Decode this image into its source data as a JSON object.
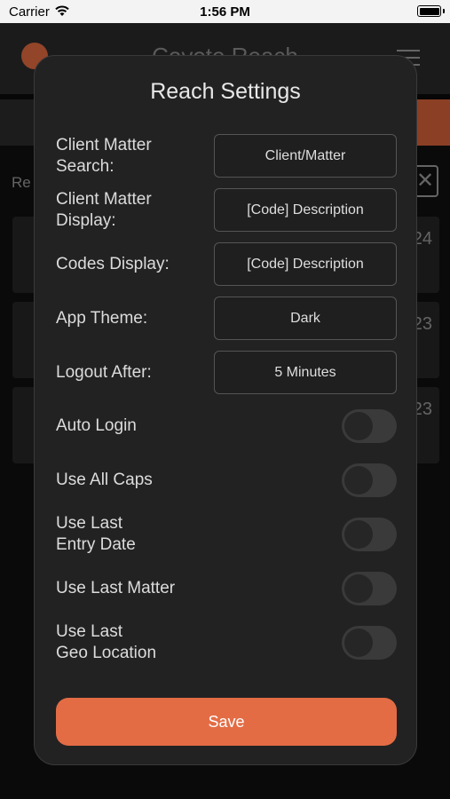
{
  "status_bar": {
    "carrier": "Carrier",
    "time": "1:56 PM"
  },
  "background": {
    "app_title": "Coyote Reach",
    "label": "Re",
    "card_numbers": [
      "24",
      "23",
      "23"
    ]
  },
  "modal": {
    "title": "Reach Settings",
    "settings": [
      {
        "label": "Client Matter\nSearch:",
        "value": "Client/Matter"
      },
      {
        "label": "Client Matter\nDisplay:",
        "value": "[Code] Description"
      },
      {
        "label": "Codes Display:",
        "value": "[Code] Description"
      },
      {
        "label": "App Theme:",
        "value": "Dark"
      },
      {
        "label": "Logout After:",
        "value": "5 Minutes"
      }
    ],
    "toggles": [
      {
        "label": "Auto Login",
        "on": false
      },
      {
        "label": "Use All Caps",
        "on": false
      },
      {
        "label": "Use Last\nEntry Date",
        "on": false
      },
      {
        "label": "Use Last Matter",
        "on": false
      },
      {
        "label": "Use Last\nGeo Location",
        "on": false
      }
    ],
    "save_label": "Save"
  },
  "colors": {
    "accent": "#e36c45",
    "modal_bg": "#222222",
    "app_bg": "#101010"
  }
}
